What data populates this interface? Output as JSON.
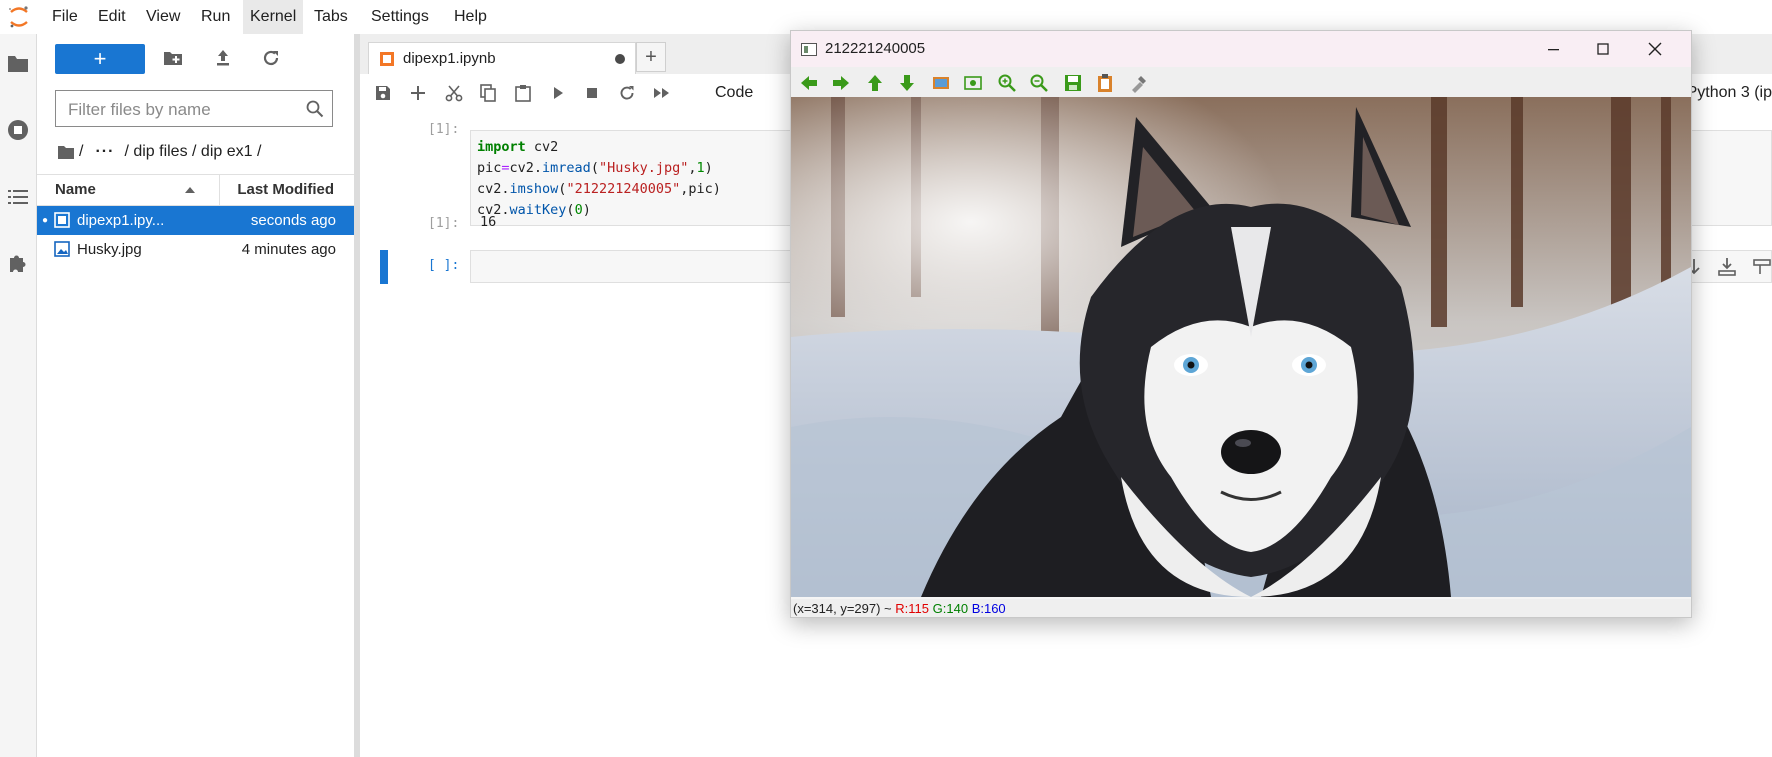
{
  "menu": {
    "items": [
      "File",
      "Edit",
      "View",
      "Run",
      "Kernel",
      "Tabs",
      "Settings",
      "Help"
    ],
    "active": "Kernel"
  },
  "activity_icons": [
    "folder-icon",
    "running-icon",
    "toc-icon",
    "extension-icon"
  ],
  "file_browser": {
    "new_label": "+",
    "filter_placeholder": "Filter files by name",
    "breadcrumb": [
      "/",
      "···",
      "/ dip files / dip ex1 /"
    ],
    "columns": {
      "name": "Name",
      "modified": "Last Modified"
    },
    "files": [
      {
        "name": "dipexp1.ipy...",
        "modified": "seconds ago",
        "selected": true,
        "running": "●",
        "icon": "notebook-icon"
      },
      {
        "name": "Husky.jpg",
        "modified": "4 minutes ago",
        "selected": false,
        "running": "",
        "icon": "image-icon"
      }
    ]
  },
  "notebook": {
    "tab_label": "dipexp1.ipynb",
    "tab_add": "+",
    "cell_type": "Code",
    "kernel": "Python 3 (ip",
    "cells": [
      {
        "prompt": "[1]:",
        "code_lines": [
          "import cv2",
          "pic=cv2.imread(\"Husky.jpg\",1)",
          "cv2.imshow(\"212221240005\",pic)",
          "cv2.waitKey(0)"
        ],
        "output_prompt": "[1]:",
        "output": "16"
      },
      {
        "prompt": "[ ]:"
      }
    ]
  },
  "image_window": {
    "title": "212221240005",
    "status": {
      "coords": "(x=314, y=297) ~",
      "r": "R:115",
      "g": "G:140",
      "b": "B:160"
    }
  },
  "colors": {
    "accent": "#1976d2",
    "toolbar_green": "#3a9a1a",
    "status_r": "#e00000",
    "status_g": "#008000",
    "status_b": "#0000e0"
  }
}
